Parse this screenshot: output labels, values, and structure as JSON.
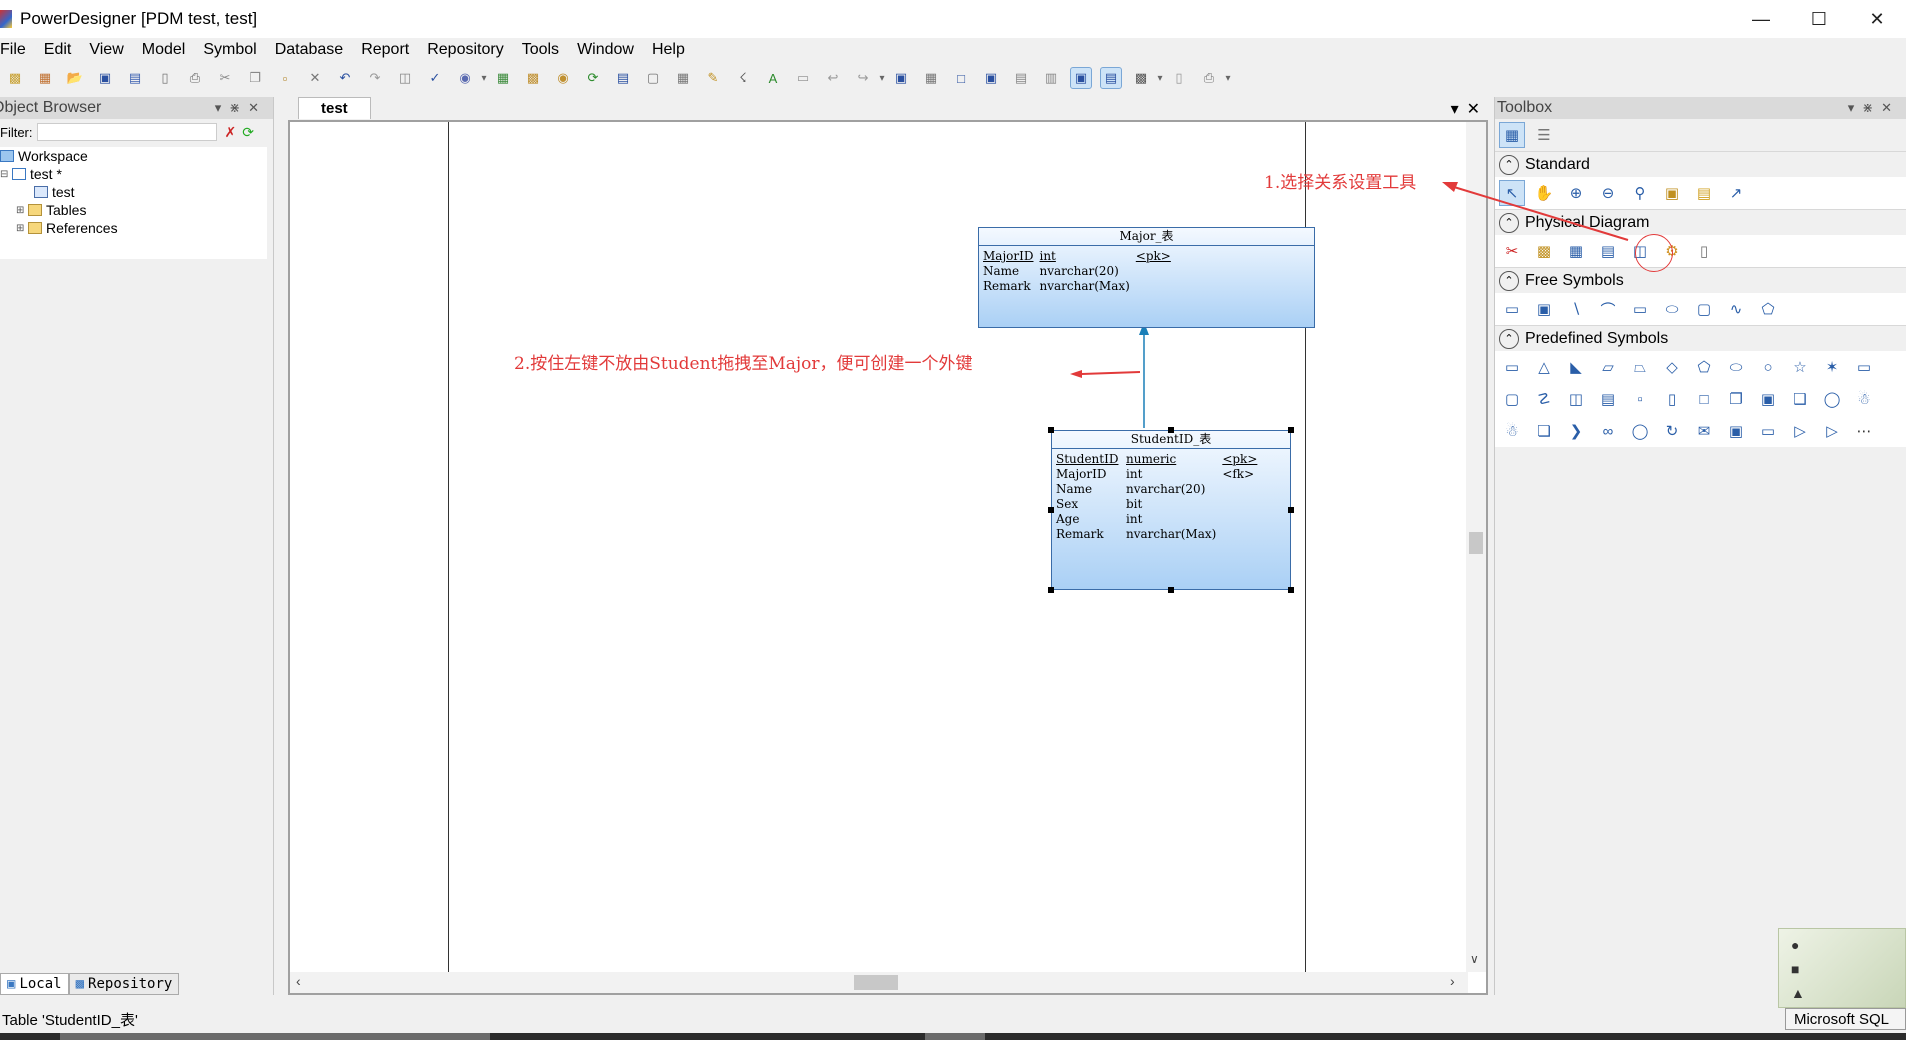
{
  "window": {
    "title": "PowerDesigner [PDM test, test]"
  },
  "menu": [
    "File",
    "Edit",
    "View",
    "Model",
    "Symbol",
    "Database",
    "Report",
    "Repository",
    "Tools",
    "Window",
    "Help"
  ],
  "object_browser": {
    "title": "Object Browser",
    "filter_label": "Filter:",
    "tree": [
      {
        "label": "Workspace"
      },
      {
        "label": "test *"
      },
      {
        "label": "test"
      },
      {
        "label": "Tables"
      },
      {
        "label": "References"
      }
    ],
    "tabs": {
      "local": "Local",
      "repository": "Repository"
    }
  },
  "document": {
    "tab": "test"
  },
  "entities": {
    "major": {
      "name": "Major_表",
      "rows": [
        [
          "MajorID",
          "int",
          "<pk>"
        ],
        [
          "Name",
          "nvarchar(20)",
          ""
        ],
        [
          "Remark",
          "nvarchar(Max)",
          ""
        ]
      ]
    },
    "student": {
      "name": "StudentID_表",
      "rows": [
        [
          "StudentID",
          "numeric",
          "<pk>"
        ],
        [
          "MajorID",
          "int",
          "<fk>"
        ],
        [
          "Name",
          "nvarchar(20)",
          ""
        ],
        [
          "Sex",
          "bit",
          ""
        ],
        [
          "Age",
          "int",
          ""
        ],
        [
          "Remark",
          "nvarchar(Max)",
          ""
        ]
      ]
    }
  },
  "annotations": {
    "step1": "1.选择关系设置工具",
    "step2": "2.按住左键不放由Student拖拽至Major，便可创建一个外键"
  },
  "toolbox": {
    "title": "Toolbox",
    "sections": {
      "standard": "Standard",
      "physical": "Physical Diagram",
      "free": "Free Symbols",
      "predefined": "Predefined Symbols"
    }
  },
  "status": {
    "left": "Table 'StudentID_表'",
    "right": "Microsoft SQL"
  },
  "colors": {
    "annotation": "#e23a3a",
    "entity_border": "#3a6ca8",
    "entity_fill": "#aad0f5"
  }
}
